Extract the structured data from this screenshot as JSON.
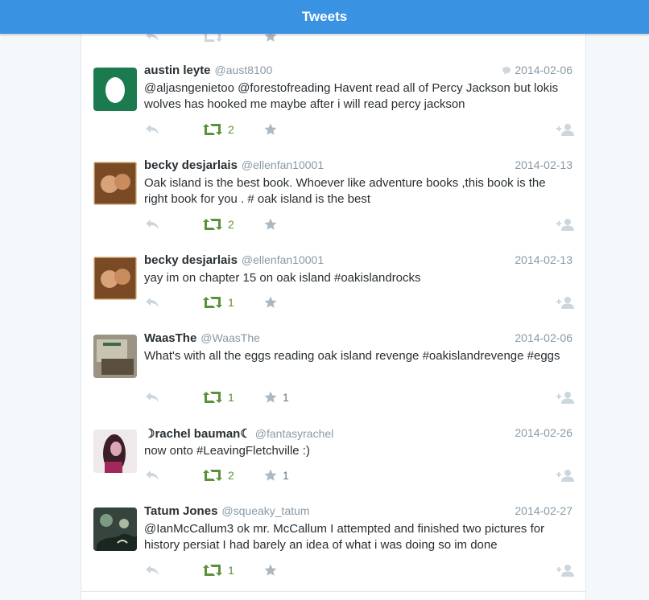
{
  "header": {
    "title": "Tweets"
  },
  "tweets": [
    {
      "name": "austin leyte",
      "handle": "@aust8100",
      "date": "2014-02-06",
      "text": "@aljasngenietoo @forestofreading Havent read all of Percy Jackson but lokis wolves has hooked me maybe after i will read percy jackson",
      "retweets": "2",
      "favorites": "",
      "conversation": true
    },
    {
      "name": "becky desjarlais",
      "handle": "@ellenfan10001",
      "date": "2014-02-13",
      "text": "Oak island is the best book. Whoever like adventure books ,this book is the right book for you . # oak island is the best",
      "retweets": "2",
      "favorites": ""
    },
    {
      "name": "becky desjarlais",
      "handle": "@ellenfan10001",
      "date": "2014-02-13",
      "text": "yay im on chapter 15 on oak island #oakislandrocks",
      "retweets": "1",
      "favorites": ""
    },
    {
      "name": "WaasThe",
      "handle": "@WaasThe",
      "date": "2014-02-06",
      "text": "What's with all the eggs reading oak island revenge #oakislandrevenge #eggs",
      "retweets": "1",
      "favorites": "1"
    },
    {
      "name": "☽rachel bauman☾",
      "handle": "@fantasyrachel",
      "date": "2014-02-26",
      "text": "now onto #LeavingFletchville :)",
      "retweets": "2",
      "favorites": "1"
    },
    {
      "name": "Tatum Jones",
      "handle": "@squeaky_tatum",
      "date": "2014-02-27",
      "text": "@IanMcCallum3 ok mr. McCallum I attempted and finished two pictures for history persiat I had barely an idea of what i was doing so im done",
      "retweets": "1",
      "favorites": ""
    }
  ]
}
